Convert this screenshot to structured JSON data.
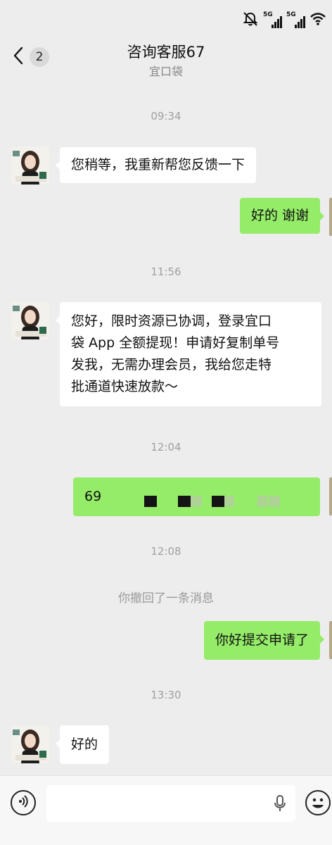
{
  "status_bar": {
    "net1": "5G",
    "net2": "5G"
  },
  "header": {
    "back_count": "2",
    "title": "咨询客服67",
    "subtitle": "宜口袋"
  },
  "chat": {
    "times": [
      "09:34",
      "11:56",
      "12:04",
      "12:08",
      "13:30"
    ],
    "messages": [
      {
        "side": "left",
        "text": "您稍等，我重新帮您反馈一下"
      },
      {
        "side": "right",
        "text": "好的 谢谢"
      },
      {
        "side": "left",
        "lines": [
          "您好，限时资源已协调，登录宜口",
          "袋 App 全额提现！申请好复制单号",
          "发我，无需办理会员，我给您走特",
          "批通道快速放款～"
        ]
      },
      {
        "side": "right",
        "text": "69"
      },
      {
        "side": "right",
        "text": "你好提交申请了"
      },
      {
        "side": "left",
        "text": "好的"
      }
    ],
    "recall_notice": "你撤回了一条消息"
  },
  "icons": {
    "mute": "bell-slash-icon",
    "wifi": "wifi-icon",
    "voice": "voice-icon",
    "mic": "microphone-icon",
    "emoji": "emoji-icon",
    "back": "chevron-left-icon"
  },
  "colors": {
    "background": "#ededed",
    "bubble_self": "#95ec69",
    "bubble_other": "#ffffff"
  }
}
